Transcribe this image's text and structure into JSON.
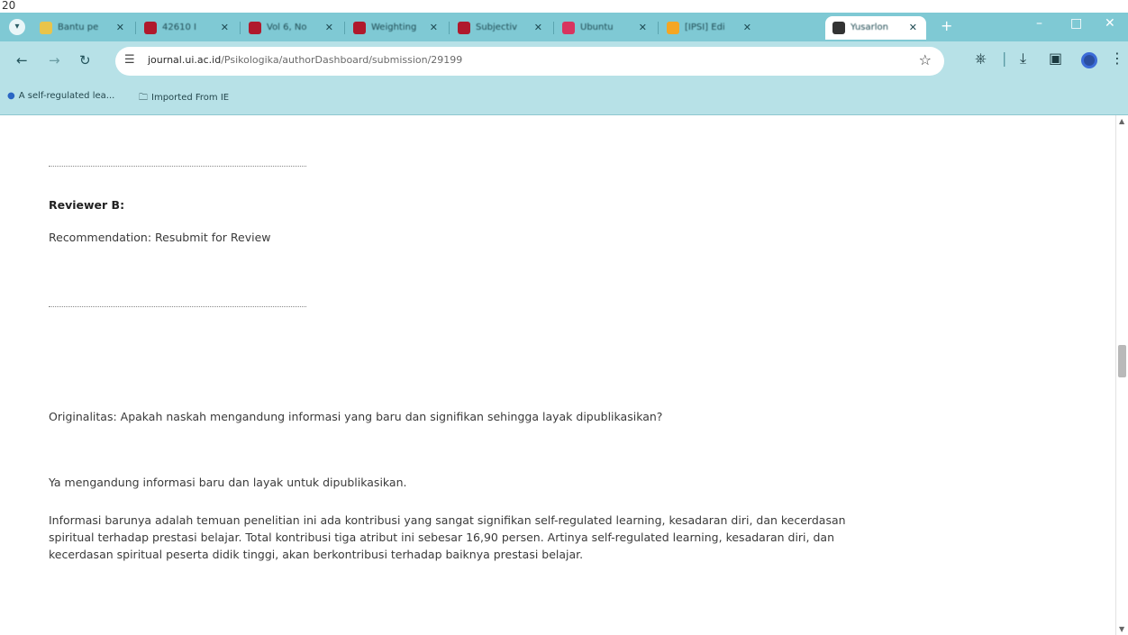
{
  "corner_label": "20",
  "browser": {
    "tabs": [
      {
        "title": "Bantu pe",
        "favicon_color": "#e9c44a"
      },
      {
        "title": "42610 I",
        "favicon_color": "#b0192c"
      },
      {
        "title": "Vol 6, No",
        "favicon_color": "#b0192c"
      },
      {
        "title": "Weighting",
        "favicon_color": "#b0192c"
      },
      {
        "title": "Subjectiv",
        "favicon_color": "#b0192c"
      },
      {
        "title": "Ubuntu",
        "favicon_color": "#d8345f"
      },
      {
        "title": "[IPSI] Edi",
        "favicon_color": "#f5a623"
      },
      {
        "title": "Yusarlon",
        "favicon_color": "#333333",
        "active": true
      }
    ],
    "new_tab": "+",
    "window_controls": {
      "minimize": "–",
      "maximize": "□",
      "close": "✕"
    },
    "toolbar": {
      "back": "←",
      "forward": "→",
      "reload": "↻",
      "url_host": "journal.ui.ac.id",
      "url_path": "/Psikologika/authorDashboard/submission/29199",
      "star": "☆"
    },
    "toolbar_icons": [
      "extensions-icon",
      "download-icon",
      "sidepanel-icon",
      "profile-icon",
      "menu-icon"
    ],
    "bookmarks": [
      {
        "label": "A self-regulated lea...",
        "icon": "globe-icon"
      },
      {
        "label": "Imported From IE",
        "icon": "folder-icon"
      }
    ]
  },
  "page": {
    "separator_1": "—",
    "reviewer_heading": "Reviewer B:",
    "recommendation": "Recommendation: Resubmit for Review",
    "separator_2": "—",
    "question": "Originalitas: Apakah naskah mengandung informasi yang baru dan signifikan sehingga layak dipublikasikan?",
    "answer": "Ya mengandung informasi baru dan layak untuk dipublikasikan.",
    "explanation": "Informasi barunya adalah temuan penelitian ini ada kontribusi yang sangat signifikan self-regulated learning, kesadaran diri, dan kecerdasan spiritual terhadap prestasi belajar. Total kontribusi tiga atribut ini sebesar 16,90 persen. Artinya self-regulated learning, kesadaran diri, dan kecerdasan spiritual peserta didik tinggi, akan berkontribusi terhadap baiknya prestasi belajar."
  },
  "scrollbar": {
    "up": "▲",
    "down": "▼",
    "position_fraction": 0.47
  }
}
